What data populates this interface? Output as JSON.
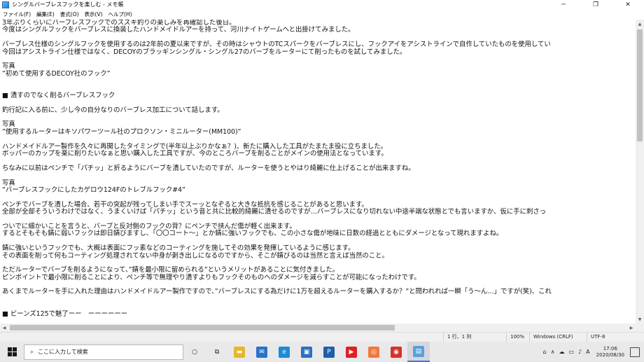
{
  "window": {
    "title": "シングルバーブレスフックを楽しむ - メモ帳",
    "minimize_glyph": "─",
    "maximize_glyph": "❐",
    "close_glyph": "✕"
  },
  "menu": {
    "file": "ファイル(F)",
    "edit": "編集(E)",
    "format": "書式(O)",
    "view": "表示(V)",
    "help": "ヘルプ(H)"
  },
  "editor": {
    "lines": [
      "3年ぶりくらいにバーブレスフックでのスズキ釣りの楽しみを再確認した後日。",
      "今度はシングルフックをバーブレスに換装したハンドメイドルアーを持って、河川ナイトゲームへと出掛けてみました。",
      "",
      "バーブレス仕様のシングルフックを使用するのは2年前の夏以来ですが、その時はシャウトのTCスパークをバーブレスにし、フックアイをアシストラインで自作していたものを使用してい",
      "今回はアシストライン仕様ではなく、DECOYのブラッギンシングル・シングル27のバーブをルーターにて削ったものを試してみました。",
      "",
      "写真",
      "”初めて使用するDECOY社のフック”",
      "",
      "",
      "■ 潰すのでなく削るバーブレスフック",
      "",
      "釣行記に入る前に、少し今の自分なりのバーブレス加工について話します。",
      "",
      "写真",
      "”使用するルーターはキソパワーツール社のプロクソン・ミニルーター(MM100)”",
      "",
      "ハンドメイドルアー製作を久々に再開したタイミングで(半年以上ぶりかなぁ？)、新たに購入した工具がたまたま役に立ちました。",
      "ボッパーのカップを楽に削りたいなぁと思い購入した工具ですが、今のところバーブを削ることがメインの使用法となっています。",
      "",
      "ちなみに以前はペンチで「パチッ」と折るようにバーブを潰していたのですが、ルーターを使うとやはり綺麗に仕上げることが出来ますね。",
      "",
      "写真",
      "”バーブレスフックにしたカゲロウ124Fのトレブルフック#4”",
      "",
      "ペンチでバーブを潰した場合、若干の突起が残ってしまい手でスーッとなぞると大きな抵抗を感じることがあると思います。",
      "全部が全部そういうわけではなく、うまくいけば「パチッ」という音と共に比較的綺麗に潰せるのですが…バーブレスになり切れない中途半端な状態とでも言いますか、仮に手に刺さっ",
      "",
      "ついでに細かいことを言うと、バーブと反対側のフックの背？にペンチで挟んだ傷が軽く出来ます。",
      "するとそもそも錆に弱いフックは即日錆びますし、「〇〇コート～」とか錆に強いフックでも、この小さな傷が地味に日数の経過とともにダメージとなって現れますよね。",
      "",
      "錆に強いというフックでも、大概は表面にフッ素などのコーティングを施してその効果を発揮しているように感じます。",
      "その表面を削って何もコーティング処理されてない中身が剥き出しになるのですから、そこが錆びるのは当然と言えば当然のこと。",
      "",
      "ただルーターでバーブを削るようになって、”錆を最小限に留められる”というメリットがあることに気付きました。",
      "ピンポイントで最小限に削ることにより、ペンチ等で無理やり潰すよりもフックそのものへのダメージを減らすことが可能になったわけです。",
      "",
      "あくまでルーターを手に入れた理由はハンドメイドルアー製作ですので、”バーブレスにする為だけに1万を超えるルーターを購入するか？”と問われれば一瞬「う～ん…」ですが(笑)、これ",
      "",
      "",
      "■ ビーンズ125で魅了ーー　ーーーーーー"
    ]
  },
  "status": {
    "position": "1 行、1 列",
    "zoom": "100%",
    "line_ending": "Windows (CRLF)",
    "encoding": "UTF-8"
  },
  "taskbar": {
    "search_placeholder": "ここに入力して検索",
    "time": "17:06",
    "date": "2020/08/30",
    "ime_label": "A",
    "pinned": [
      {
        "name": "cortana-icon",
        "glyph": "○",
        "color": "#1a1a1a"
      },
      {
        "name": "task-view-icon",
        "glyph": "⧉",
        "color": "#1a1a1a"
      },
      {
        "name": "file-explorer-icon",
        "glyph": "▬",
        "color": "#e8b52c"
      },
      {
        "name": "mail-icon",
        "glyph": "✉",
        "color": "#2a72c8"
      },
      {
        "name": "edge-icon",
        "glyph": "e",
        "color": "#1f8ad2"
      },
      {
        "name": "store-icon",
        "glyph": "▣",
        "color": "#2c6fbf"
      },
      {
        "name": "ps-icon",
        "glyph": "P",
        "color": "#1e5fa8"
      },
      {
        "name": "youtube-icon",
        "glyph": "▶",
        "color": "#e02020"
      },
      {
        "name": "app-orange-icon",
        "glyph": "◎",
        "color": "#f07a3a"
      },
      {
        "name": "app-red-icon",
        "glyph": "◉",
        "color": "#d8312a"
      },
      {
        "name": "notepad-icon",
        "glyph": "▤",
        "color": "#5aa0d8"
      }
    ]
  },
  "colors": {
    "accent": "#3a78d8",
    "scroll_thumb": "#c1c1c1",
    "taskbar_bg": "#e9e9ec"
  }
}
